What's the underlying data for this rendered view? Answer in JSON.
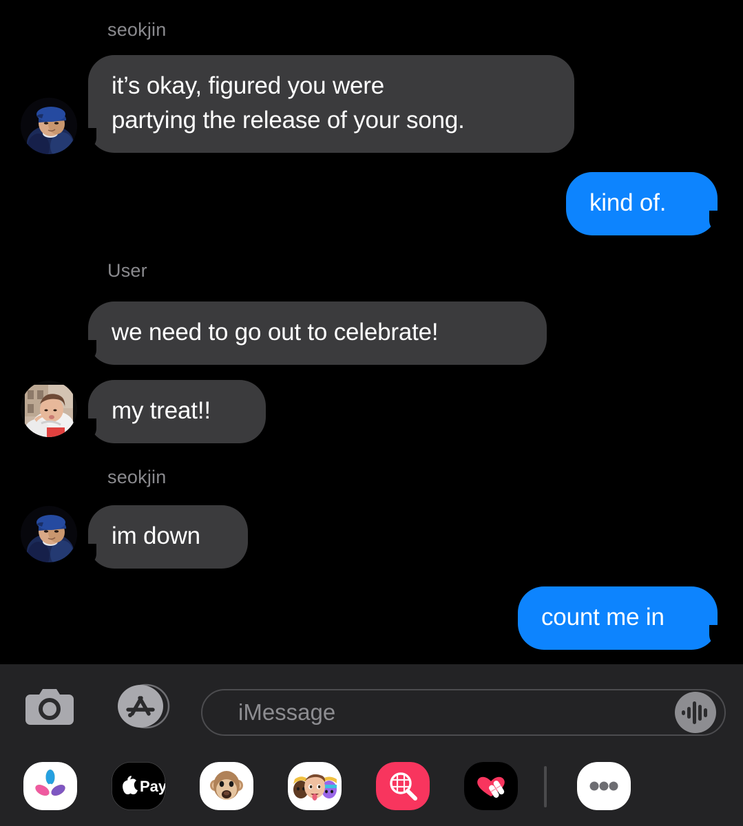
{
  "app": {
    "name": "Messages",
    "platform": "iOS",
    "theme": "dark",
    "background_color": "#000000",
    "incoming_bubble_color": "#3b3b3d",
    "outgoing_bubble_color": "#0d84fe",
    "sender_label_color": "#8a8a8e",
    "bar_background_color": "#232325"
  },
  "thread": {
    "messages": [
      {
        "sender_label": "seokjin",
        "text": "it’s okay, figured you were\npartying the release of your song.",
        "direction": "incoming",
        "has_avatar": true,
        "avatar_name": "avatar-seokjin"
      },
      {
        "sender_label": "",
        "text": "kind of.",
        "direction": "outgoing",
        "has_avatar": false,
        "avatar_name": ""
      },
      {
        "sender_label": "User",
        "text": "we need to go out to celebrate!",
        "direction": "incoming",
        "has_avatar": false,
        "avatar_name": ""
      },
      {
        "sender_label": "",
        "text": "my treat!!",
        "direction": "incoming",
        "has_avatar": true,
        "avatar_name": "avatar-user"
      },
      {
        "sender_label": "seokjin",
        "text": "im down",
        "direction": "incoming",
        "has_avatar": true,
        "avatar_name": "avatar-seokjin"
      },
      {
        "sender_label": "",
        "text": "count me in",
        "direction": "outgoing",
        "has_avatar": false,
        "avatar_name": ""
      }
    ]
  },
  "composer": {
    "camera_icon": "camera-icon",
    "appstore_icon": "app-store-icon",
    "placeholder": "iMessage",
    "input_value": "",
    "audio_icon": "audio-waveform-icon"
  },
  "app_drawer": {
    "items": [
      {
        "name": "photos-app-icon",
        "label": "Photos"
      },
      {
        "name": "apple-pay-app-icon",
        "label": "Pay"
      },
      {
        "name": "animoji-app-icon",
        "label": "Animoji"
      },
      {
        "name": "memoji-stickers-app-icon",
        "label": "Memoji Stickers"
      },
      {
        "name": "images-search-app-icon",
        "label": "#images"
      },
      {
        "name": "digital-touch-app-icon",
        "label": "Digital Touch"
      }
    ],
    "more_button": {
      "name": "more-apps-button",
      "label": "More"
    }
  }
}
